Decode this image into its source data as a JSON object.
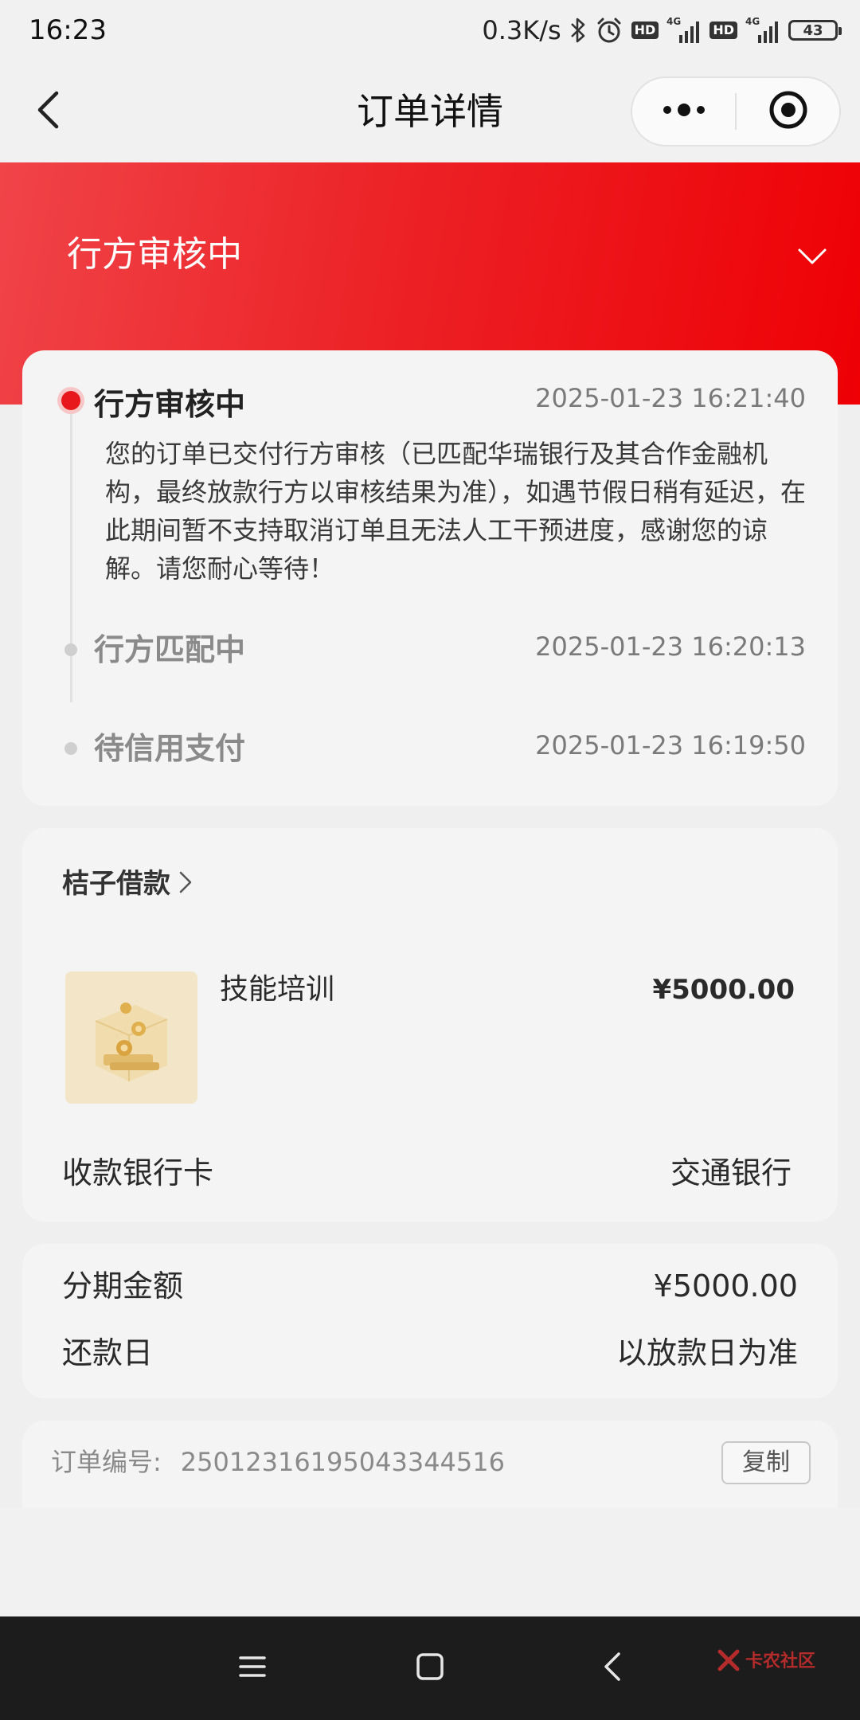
{
  "status_bar": {
    "time": "16:23",
    "net_speed": "0.3K/s",
    "hd_badge": "HD",
    "network": "4G",
    "battery": "43"
  },
  "title_bar": {
    "title": "订单详情",
    "icons": [
      "back-icon",
      "more-icon",
      "target-icon"
    ]
  },
  "header": {
    "status": "行方审核中",
    "icon": "chevron-down-icon"
  },
  "timeline": [
    {
      "title": "行方审核中",
      "time": "2025-01-23 16:21:40",
      "desc": "您的订单已交付行方审核（已匹配华瑞银行及其合作金融机构，最终放款行方以审核结果为准），如遇节假日稍有延迟，在此期间暂不支持取消订单且无法人工干预进度，感谢您的谅解。请您耐心等待！"
    },
    {
      "title": "行方匹配中",
      "time": "2025-01-23 16:20:13"
    },
    {
      "title": "待信用支付",
      "time": "2025-01-23 16:19:50"
    }
  ],
  "product": {
    "merchant": "桔子借款",
    "name": "技能培训",
    "price": "¥5000.00",
    "bank_label": "收款银行卡",
    "bank_value": "交通银行"
  },
  "installment": {
    "amount_label": "分期金额",
    "amount_value": "¥5000.00",
    "repay_label": "还款日",
    "repay_value": "以放款日为准"
  },
  "order": {
    "number_label": "订单编号:",
    "number_value": "25012316195043344516",
    "copy_label": "复制"
  },
  "nav": {
    "icons": [
      "menu-icon",
      "home-icon",
      "back-icon"
    ],
    "watermark": "卡农社区"
  },
  "colors": {
    "accent": "#e8171c",
    "header_gradient_start": "#f04449",
    "header_gradient_end": "#ee0005",
    "background": "#efefef",
    "card": "#f4f4f4"
  }
}
